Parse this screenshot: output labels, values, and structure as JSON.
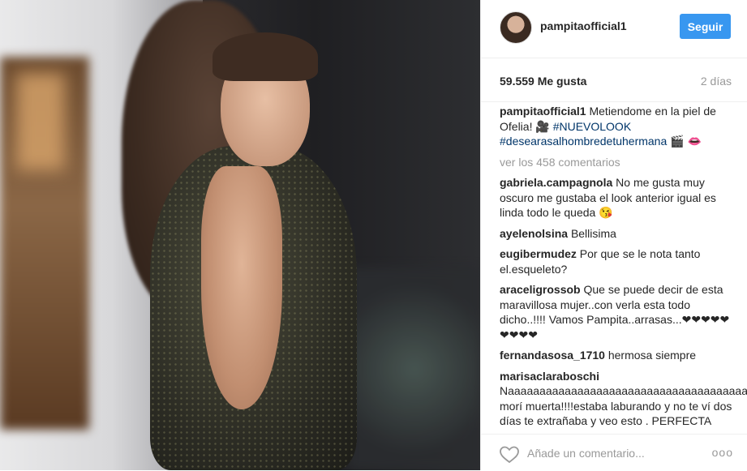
{
  "post": {
    "username": "pampitaofficial1",
    "follow_label": "Seguir",
    "likes": "59.559 Me gusta",
    "time": "2 días",
    "caption": {
      "user": "pampitaofficial1",
      "text": "Metiendome en la piel de Ofelia! 🎥",
      "hashtag1": "#NUEVOLOOK",
      "hashtag2": "#desearasalhombredetuhermana",
      "emoji_tail": "🎬 👄"
    },
    "view_comments": "ver los 458 comentarios",
    "comments": [
      {
        "user": "gabriela.campagnola",
        "text": "No me gusta muy oscuro me gustaba el look anterior igual es linda todo le queda 😘"
      },
      {
        "user": "ayelenolsina",
        "text": "Bellisima"
      },
      {
        "user": "eugibermudez",
        "text": "Por que se le nota tanto el.esqueleto?"
      },
      {
        "user": "araceligrossob",
        "text": "Que se puede decir de esta maravillosa mujer..con verla esta todo dicho..!!!! Vamos Pampita..arrasas...❤❤❤❤❤❤❤❤❤"
      },
      {
        "user": "fernandasosa_1710",
        "text": "hermosa siempre"
      },
      {
        "user": "marisaclaraboschi",
        "text": "Naaaaaaaaaaaaaaaaaaaaaaaaaaaaaaaaaaaaaa.me morí muerta!!!!estaba laburando y no te ví dos días te extrañaba y veo esto . PERFECTA"
      }
    ],
    "add_comment_placeholder": "Añade un comentario...",
    "more_icon": "ooo",
    "heart_icon": "heart-outline-icon"
  }
}
